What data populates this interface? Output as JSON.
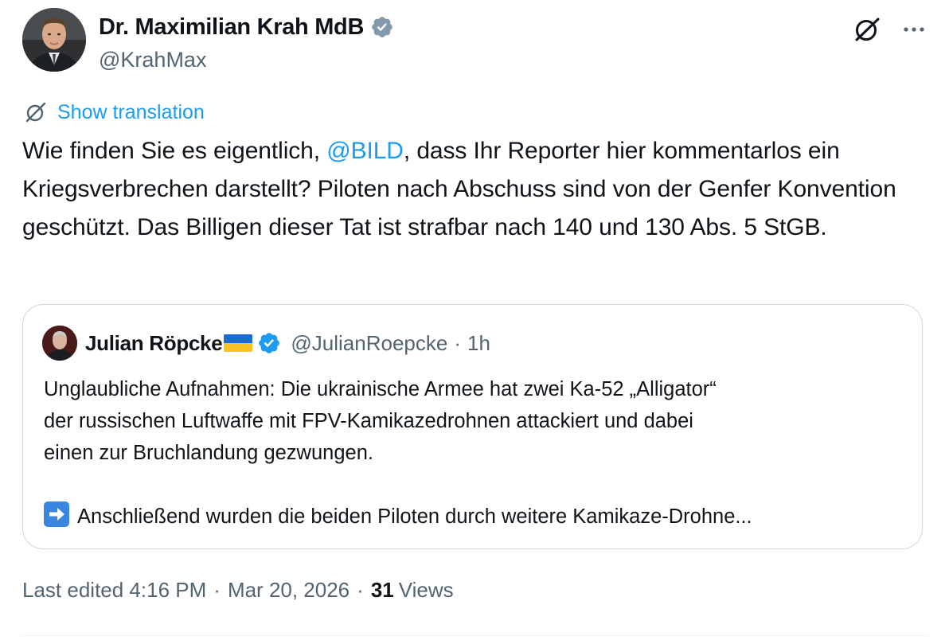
{
  "author": {
    "display_name": "Dr. Maximilian Krah MdB",
    "handle": "@KrahMax",
    "verified": true,
    "verified_color": "#829aab"
  },
  "actions": {
    "grok_icon": "grok-icon",
    "more_icon": "more-icon"
  },
  "translation": {
    "label": "Show translation",
    "icon": "grok-icon"
  },
  "post": {
    "text_before_mention": "Wie finden Sie es eigentlich, ",
    "mention": "@BILD",
    "text_after_mention": ", dass Ihr Reporter hier kommentarlos ein Kriegsverbrechen darstellt? Piloten nach Abschuss sind von der Genfer Konvention geschützt. Das Billigen dieser Tat ist strafbar nach 140 und 130 Abs. 5 StGB."
  },
  "quoted": {
    "display_name": "Julian Röpcke",
    "flag": "ukraine-flag",
    "verified": true,
    "verified_color": "#1d9bf0",
    "handle": "@JulianRoepcke",
    "separator": "·",
    "time": "1h",
    "lines": [
      "Unglaubliche Aufnahmen: Die ukrainische Armee hat zwei Ka-52 „Alligator“",
      "der russischen Luftwaffe mit FPV-Kamikazedrohnen attackiert und dabei",
      "einen zur Bruchlandung gezwungen."
    ],
    "last_line_emoji": "right-arrow-emoji",
    "last_line": "Anschließend wurden die beiden Piloten durch weitere Kamikaze-Drohne..."
  },
  "meta": {
    "edited": "Last edited 4:16 PM",
    "separator": "·",
    "date": "Mar 20, 2026",
    "views_count": "31",
    "views_label": "Views"
  },
  "colors": {
    "link": "#1d9bf0",
    "secondary": "#536471",
    "text": "#0f1419",
    "border": "#cfd9de"
  }
}
